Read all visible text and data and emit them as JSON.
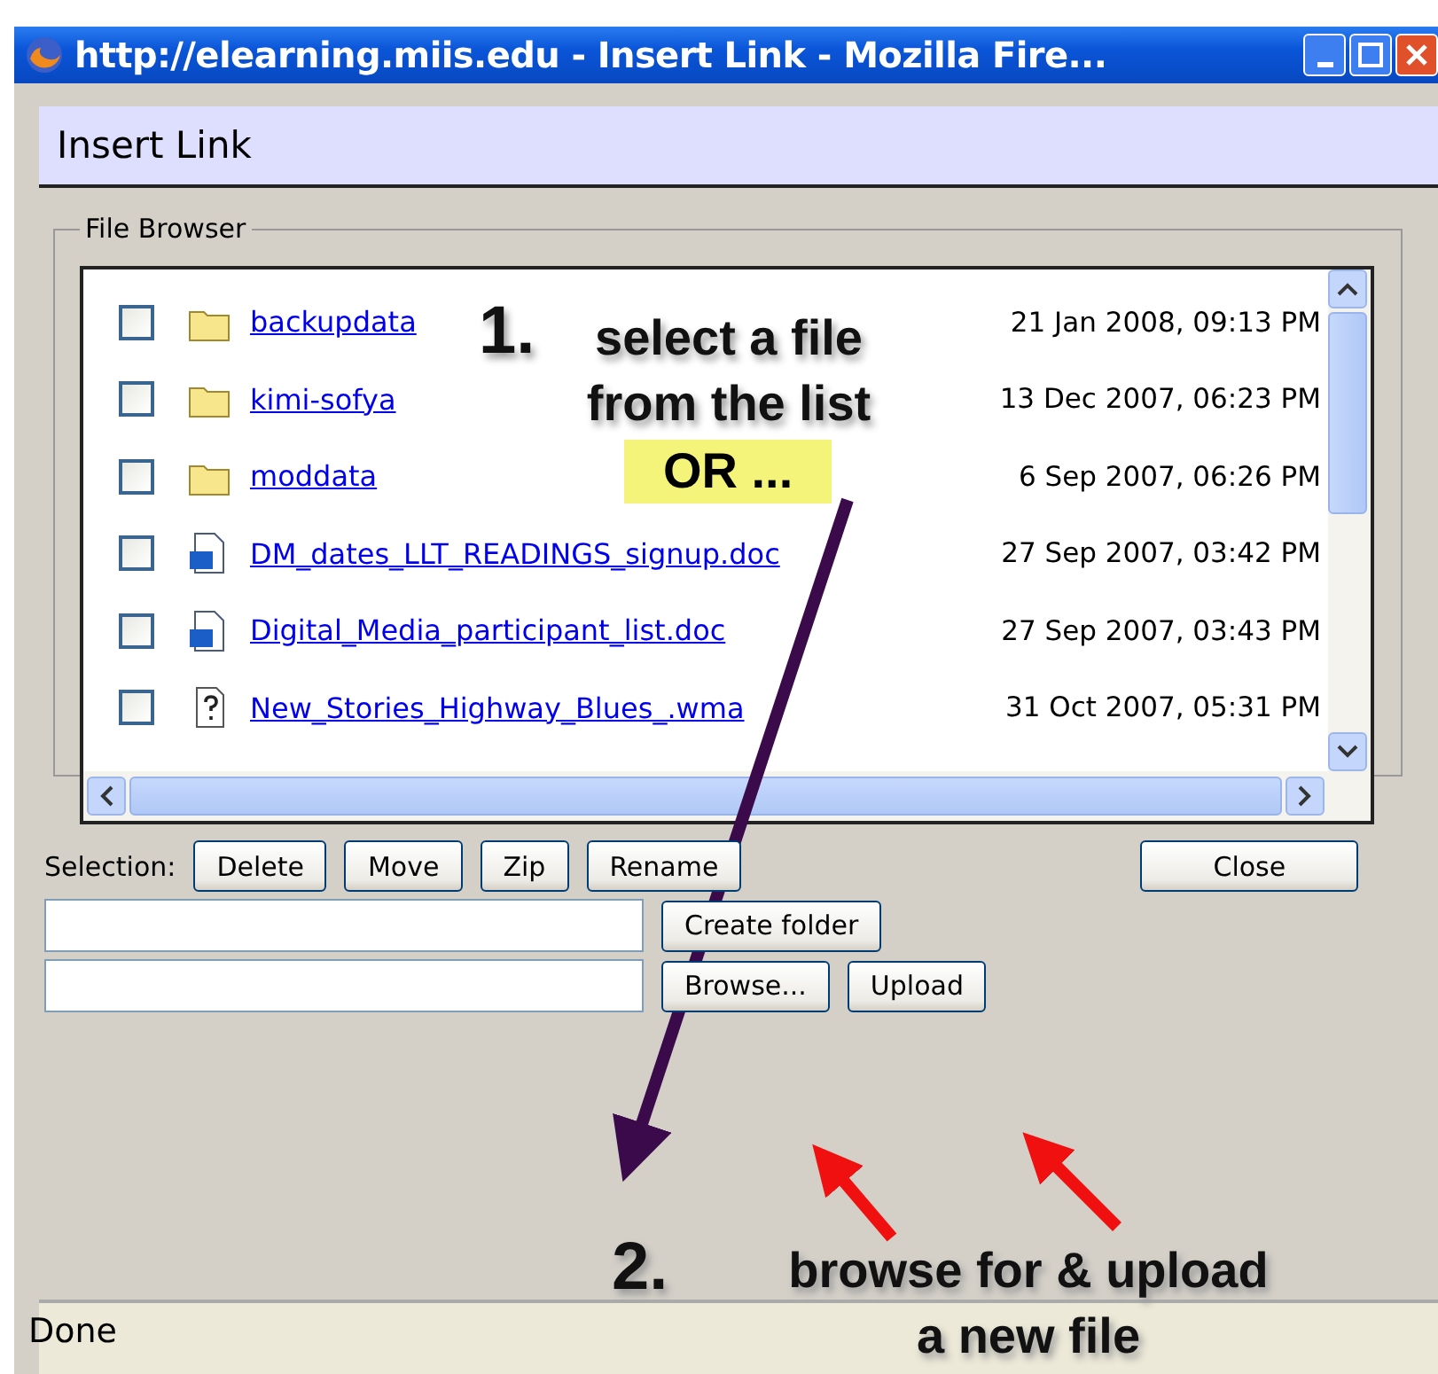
{
  "window": {
    "title": "http://elearning.miis.edu - Insert Link - Mozilla Fire..."
  },
  "dialog": {
    "title": "Insert Link"
  },
  "file_browser": {
    "legend": "File Browser",
    "files": [
      {
        "kind": "folder",
        "name": "backupdata",
        "date": "21 Jan 2008, 09:13 PM",
        "checked": false
      },
      {
        "kind": "folder",
        "name": "kimi-sofya",
        "date": "13 Dec 2007, 06:23 PM",
        "checked": false
      },
      {
        "kind": "folder",
        "name": "moddata",
        "date": "6 Sep 2007, 06:26 PM",
        "checked": false
      },
      {
        "kind": "word",
        "name": "DM_dates_LLT_READINGS_signup.doc",
        "date": "27 Sep 2007, 03:42 PM",
        "checked": false
      },
      {
        "kind": "word",
        "name": "Digital_Media_participant_list.doc",
        "date": "27 Sep 2007, 03:43 PM",
        "checked": false
      },
      {
        "kind": "unknown",
        "name": "New_Stories_Highway_Blues_.wma",
        "date": "31 Oct 2007, 05:31 PM",
        "checked": false
      }
    ]
  },
  "selection": {
    "label": "Selection:",
    "buttons": [
      "Delete",
      "Move",
      "Zip",
      "Rename"
    ],
    "close": "Close"
  },
  "create_folder": {
    "button": "Create folder"
  },
  "upload": {
    "browse": "Browse...",
    "upload": "Upload"
  },
  "status_bar": {
    "text": "Done"
  },
  "annotations": [
    {
      "number": "1.",
      "lines": [
        "select a file",
        "from the list"
      ],
      "highlight": "OR ..."
    },
    {
      "number": "2.",
      "lines": [
        "browse for & upload",
        "a new file"
      ]
    }
  ]
}
